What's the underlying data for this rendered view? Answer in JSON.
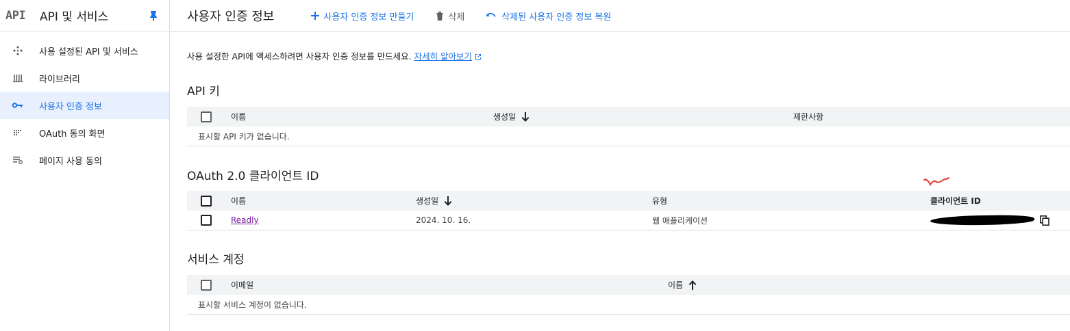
{
  "sidebar": {
    "logo": "API",
    "title": "API 및 서비스",
    "items": [
      {
        "label": "사용 설정된 API 및 서비스",
        "icon": "api-dots-icon"
      },
      {
        "label": "라이브러리",
        "icon": "library-icon"
      },
      {
        "label": "사용자 인증 정보",
        "icon": "key-icon",
        "active": true
      },
      {
        "label": "OAuth 동의 화면",
        "icon": "consent-dots-icon"
      },
      {
        "label": "페이지 사용 동의",
        "icon": "settings-list-icon"
      }
    ]
  },
  "topbar": {
    "title": "사용자 인증 정보",
    "create_label": "사용자 인증 정보 만들기",
    "delete_label": "삭제",
    "restore_label": "삭제된 사용자 인증 정보 복원"
  },
  "intro": {
    "text": "사용 설정한 API에 액세스하려면 사용자 인증 정보를 만드세요.",
    "link": "자세히 알아보기"
  },
  "api_keys": {
    "title": "API 키",
    "columns": [
      "이름",
      "생성일",
      "제한사항"
    ],
    "empty": "표시할 API 키가 없습니다."
  },
  "oauth": {
    "title": "OAuth 2.0 클라이언트 ID",
    "columns": [
      "이름",
      "생성일",
      "유형",
      "클라이언트 ID"
    ],
    "rows": [
      {
        "name": "Readly",
        "created": "2024. 10. 16.",
        "type": "웹 애플리케이션"
      }
    ]
  },
  "service_accounts": {
    "title": "서비스 계정",
    "columns": [
      "이메일",
      "이름"
    ],
    "empty": "표시할 서비스 계정이 없습니다."
  },
  "colors": {
    "accent": "#1a73e8",
    "active_bg": "#e8f0fe",
    "link_visited": "#7b1fa2",
    "header_bg": "#f1f3f4",
    "annotation": "#e53935"
  }
}
